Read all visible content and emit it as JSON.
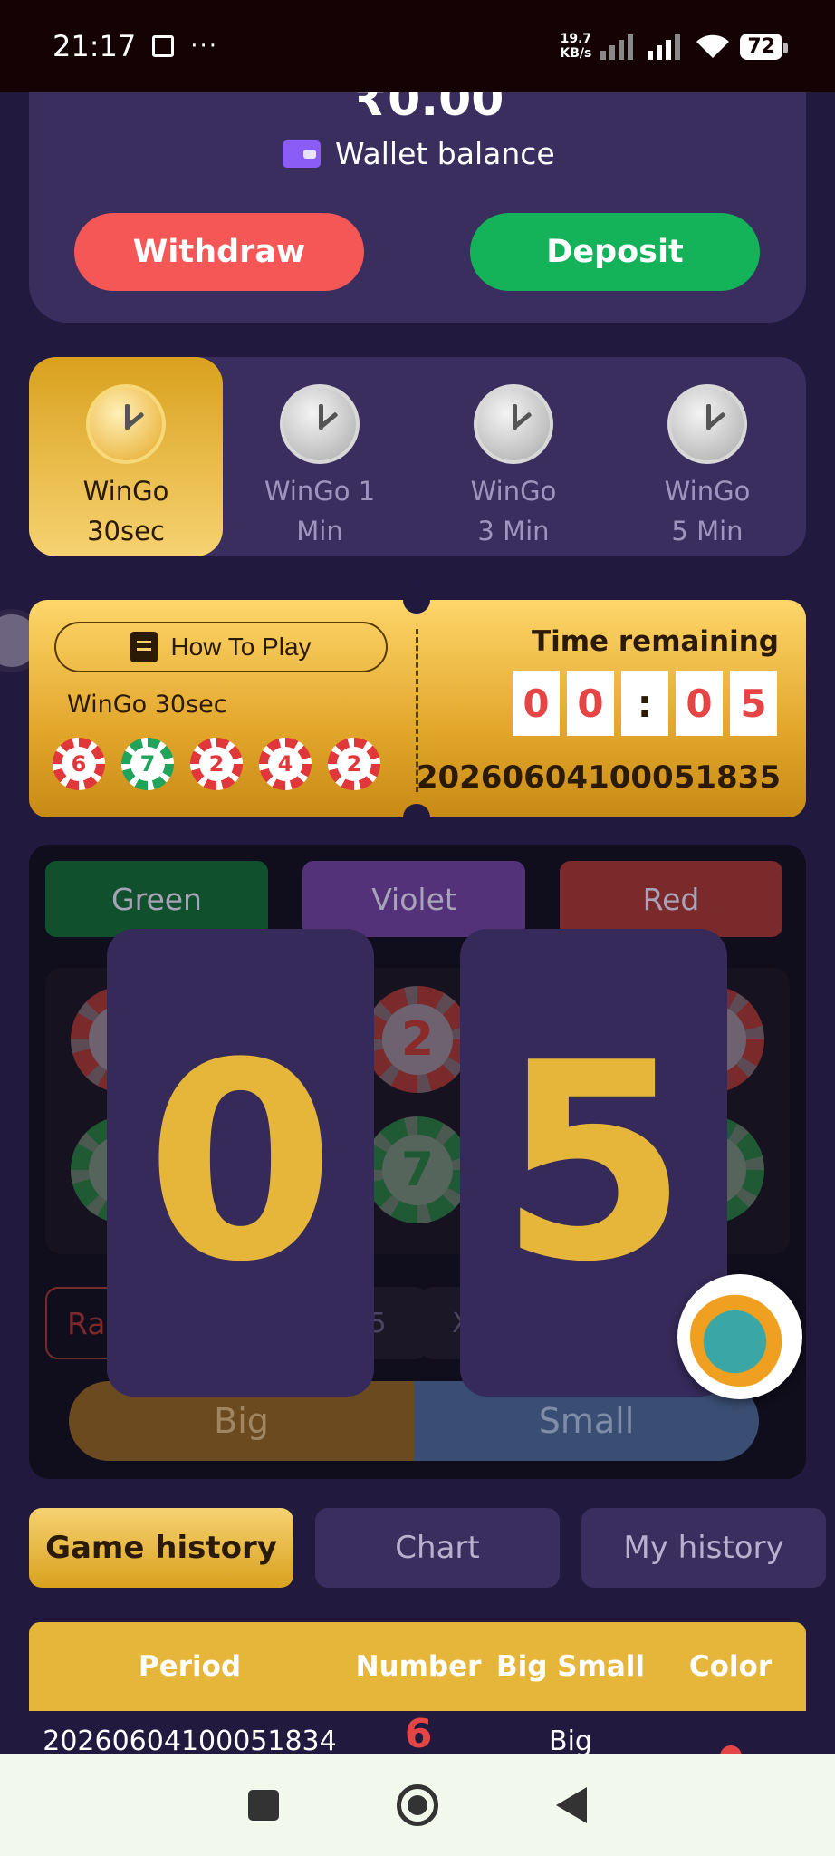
{
  "status_bar": {
    "time": "21:17",
    "dots": "···",
    "net_speed_value": "19.7",
    "net_speed_unit": "KB/s",
    "battery": "72"
  },
  "wallet": {
    "amount_partial": "₹0.00",
    "label": "Wallet balance",
    "withdraw_label": "Withdraw",
    "deposit_label": "Deposit"
  },
  "game_tabs": [
    {
      "line1": "WinGo",
      "line2": "30sec",
      "active": true
    },
    {
      "line1": "WinGo 1",
      "line2": "Min",
      "active": false
    },
    {
      "line1": "WinGo",
      "line2": "3 Min",
      "active": false
    },
    {
      "line1": "WinGo",
      "line2": "5 Min",
      "active": false
    }
  ],
  "ticket": {
    "how_to_play": "How To Play",
    "game_name": "WinGo 30sec",
    "recent_results": [
      "6",
      "7",
      "2",
      "4",
      "2"
    ],
    "time_label": "Time remaining",
    "timer_digits": [
      "0",
      "0",
      ":",
      "0",
      "5"
    ],
    "period_number": "20260604100051835"
  },
  "bet_panel": {
    "colors": [
      "Green",
      "Violet",
      "Red"
    ],
    "visible_numbers": [
      "2",
      "7"
    ],
    "random_label": "Ra",
    "mult_labels": [
      "5",
      "X1"
    ],
    "big_label": "Big",
    "small_label": "Small"
  },
  "countdown_overlay": [
    "0",
    "5"
  ],
  "history_tabs": {
    "game_history": "Game history",
    "chart": "Chart",
    "my_history": "My history"
  },
  "table": {
    "headers": [
      "Period",
      "Number",
      "Big Small",
      "Color"
    ],
    "rows": [
      {
        "period": "20260604100051834",
        "number": "6",
        "big_small": "Big",
        "color": "red"
      }
    ]
  },
  "colors": {
    "background": "#22193f",
    "card": "#3a2e5f",
    "gold": "#e5b63a",
    "withdraw": "#f55656",
    "deposit": "#14b35a",
    "red": "#e64545"
  }
}
